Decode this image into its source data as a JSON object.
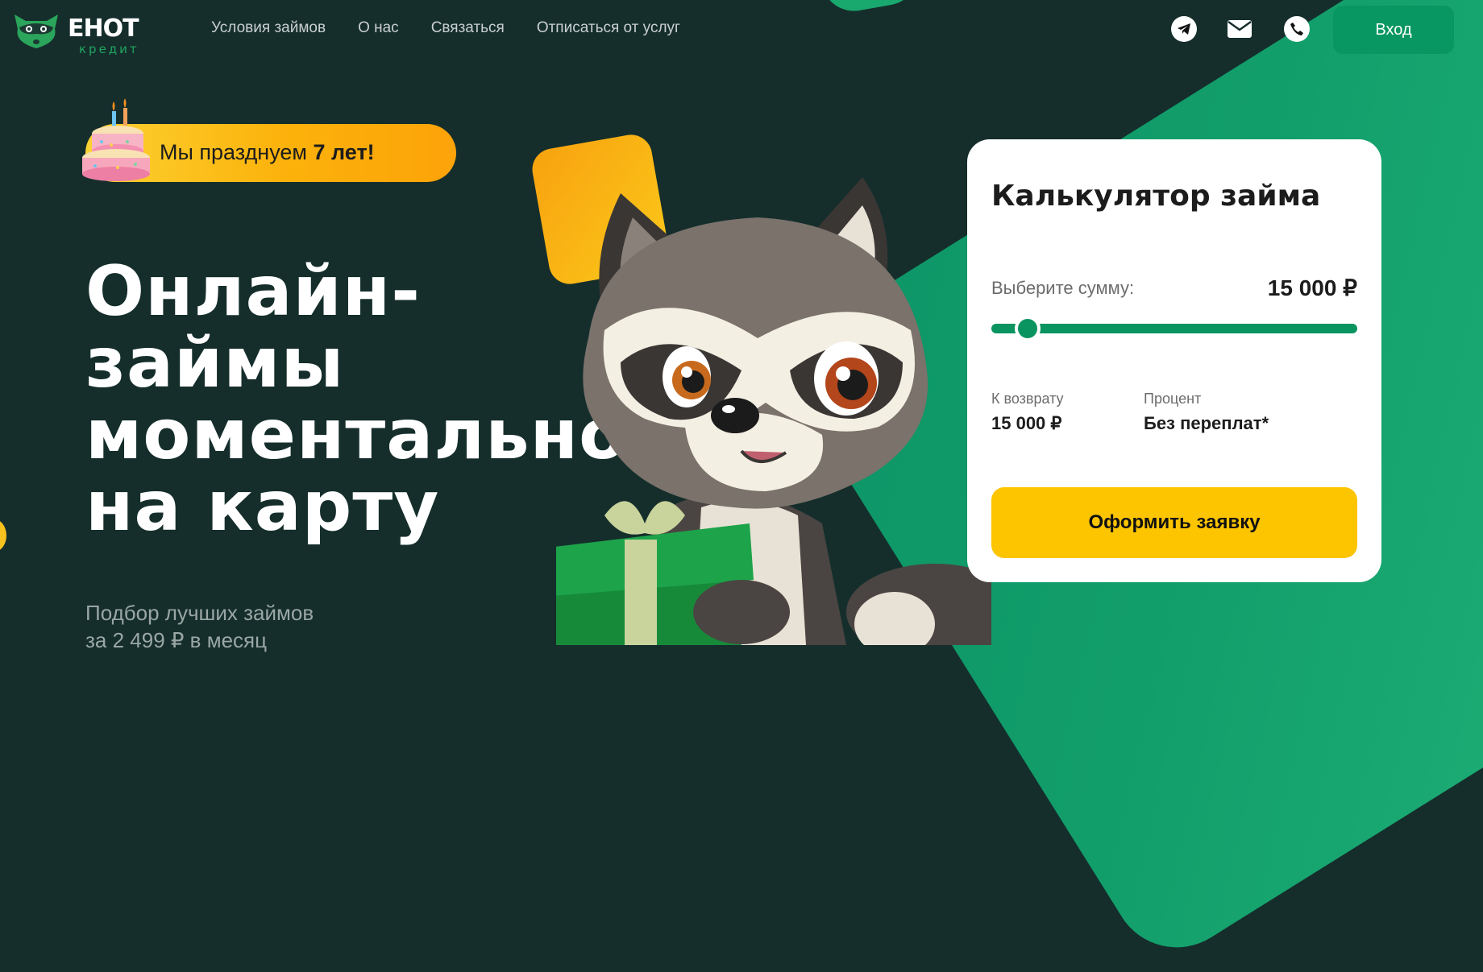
{
  "header": {
    "logo": {
      "word": "ЕНОТ",
      "sub": "кредит"
    },
    "nav": [
      "Условия займов",
      "О нас",
      "Связаться",
      "Отписаться от услуг"
    ],
    "icons": [
      "telegram-icon",
      "mail-icon",
      "phone-icon"
    ],
    "login_label": "Вход"
  },
  "badge": {
    "text": "Мы празднуем ",
    "highlight": "7 лет!"
  },
  "hero": {
    "title_lines": [
      "Онлайн-",
      "займы",
      "моментально",
      "на карту"
    ],
    "subtitle_lines": [
      "Подбор лучших займов",
      "за 2 499 ₽ в месяц"
    ]
  },
  "calculator": {
    "title": "Калькулятор займа",
    "sum_label": "Выберите сумму:",
    "sum_value": "15 000 ₽",
    "slider_fraction": 0.04,
    "return_label": "К возврату",
    "return_value": "15 000 ₽",
    "percent_label": "Процент",
    "percent_value": "Без переплат*",
    "apply_label": "Оформить заявку"
  },
  "colors": {
    "background": "#152e2c",
    "accent_green": "#089763",
    "accent_yellow": "#fdc400"
  }
}
